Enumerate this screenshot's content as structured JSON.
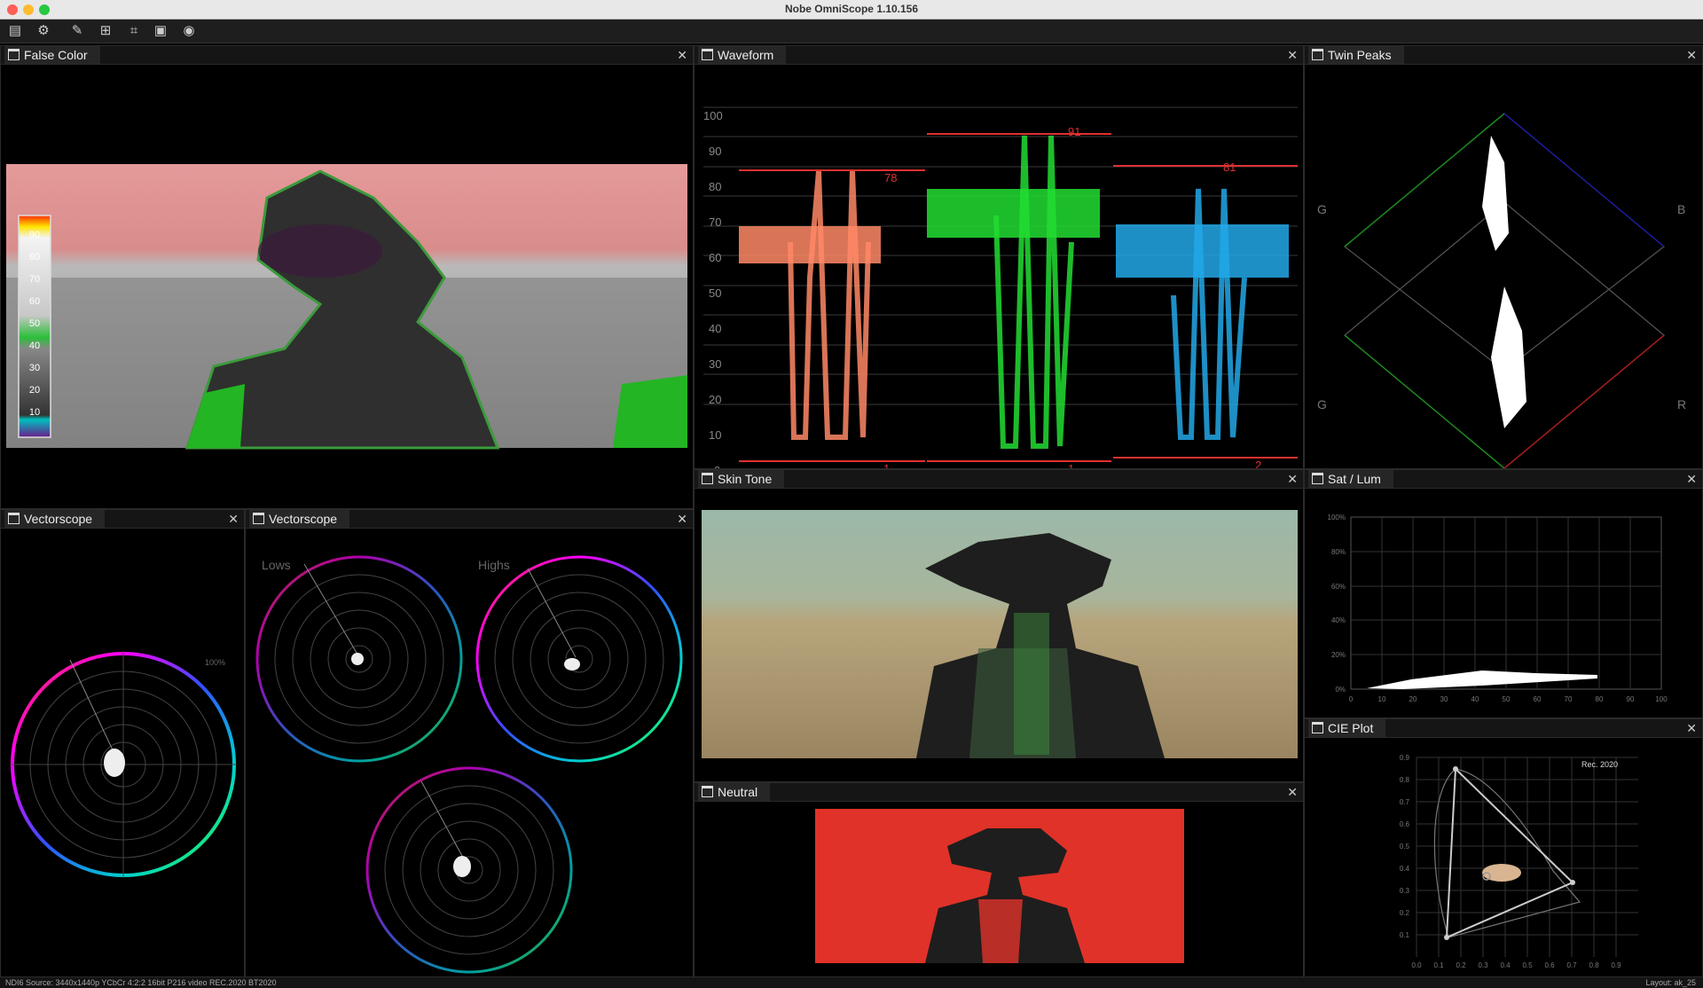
{
  "window": {
    "title": "Nobe OmniScope 1.10.156"
  },
  "toolbar": {
    "icons": [
      "film-icon",
      "settings-icon",
      "wrench-icon",
      "network-icon",
      "crop-icon",
      "layers-icon",
      "camera-icon"
    ]
  },
  "panels": {
    "false_color": {
      "title": "False Color",
      "legend": [
        "90",
        "80",
        "70",
        "60",
        "50",
        "40",
        "30",
        "20",
        "10"
      ]
    },
    "waveform": {
      "title": "Waveform",
      "scale": [
        "100",
        "90",
        "80",
        "70",
        "60",
        "50",
        "40",
        "30",
        "20",
        "10",
        "0"
      ],
      "channel_peaks": [
        "78",
        "91",
        "81"
      ],
      "channel_lows": [
        "1",
        "1",
        "2"
      ]
    },
    "twin_peaks": {
      "title": "Twin Peaks",
      "labels": {
        "g_top": "G",
        "b": "B",
        "g_bottom": "G",
        "r": "R"
      }
    },
    "vectorscope1": {
      "title": "Vectorscope",
      "scale_label": "100%"
    },
    "vectorscope2": {
      "title": "Vectorscope",
      "lows": "Lows",
      "highs": "Highs"
    },
    "skin_tone": {
      "title": "Skin Tone"
    },
    "sat_lum": {
      "title": "Sat / Lum",
      "y_ticks": [
        "100%",
        "80%",
        "60%",
        "40%",
        "20%",
        "0%"
      ],
      "x_ticks": [
        "0",
        "10",
        "20",
        "30",
        "40",
        "50",
        "60",
        "70",
        "80",
        "90",
        "100"
      ]
    },
    "neutral": {
      "title": "Neutral"
    },
    "cie": {
      "title": "CIE Plot",
      "gamut_label": "Rec. 2020",
      "y_ticks": [
        "0.9",
        "0.8",
        "0.7",
        "0.6",
        "0.5",
        "0.4",
        "0.3",
        "0.2",
        "0.1"
      ],
      "x_ticks": [
        "0.0",
        "0.1",
        "0.2",
        "0.3",
        "0.4",
        "0.5",
        "0.6",
        "0.7",
        "0.8",
        "0.9"
      ]
    }
  },
  "status": {
    "source": "NDI6 Source: 3440x1440p YCbCr 4:2:2 16bit P216 video REC.2020 BT2020",
    "layout": "Layout: ak_25"
  }
}
